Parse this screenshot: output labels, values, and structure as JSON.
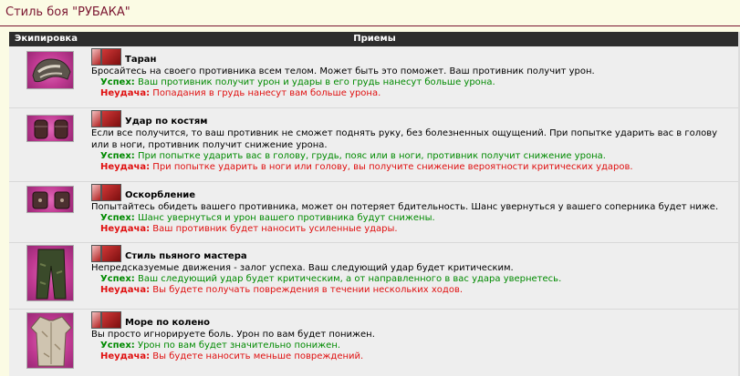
{
  "page": {
    "title": "Стиль боя \"РУБАКА\""
  },
  "table": {
    "col_equipment": "Экипировка",
    "col_moves": "Приемы"
  },
  "moves": [
    {
      "equip_icon": "helmet-icon",
      "name": "Таран",
      "desc": "Бросайтесь на своего противника всем телом. Может быть это поможет. Ваш противник получит урон.",
      "success_label": "Успех:",
      "success": "Ваш противник получит урон и удары в его грудь нанесут больше урона.",
      "fail_label": "Неудача:",
      "fail": "Попадания в грудь нанесут вам больше урона."
    },
    {
      "equip_icon": "gloves-icon",
      "name": "Удар по костям",
      "desc": "Если все получится, то ваш противник не сможет поднять руку, без болезненных ощущений. При попытке ударить вас в голову или в ноги, противник получит снижение урона.",
      "success_label": "Успех:",
      "success": "При попытке ударить вас в голову, грудь, пояс или в ноги, противник получит снижение урона.",
      "fail_label": "Неудача:",
      "fail": "При попытке ударить в ноги или голову, вы получите снижение вероятности критических ударов."
    },
    {
      "equip_icon": "bracers-icon",
      "name": "Оскорбление",
      "desc": "Попытайтесь обидеть вашего противника, может он потеряет бдительность. Шанс увернуться у вашего соперника будет ниже.",
      "success_label": "Успех:",
      "success": "Шанс увернуться и урон вашего противника будут снижены.",
      "fail_label": "Неудача:",
      "fail": "Ваш противник будет наносить усиленные удары."
    },
    {
      "equip_icon": "pants-icon",
      "name": "Стиль пьяного мастера",
      "desc": "Непредсказуемые движения - залог успеха. Ваш следующий удар будет критическим.",
      "success_label": "Успех:",
      "success": "Ваш следующий удар будет критическим, а от направленного в вас удара увернетесь.",
      "fail_label": "Неудача:",
      "fail": "Вы будете получать повреждения в течении нескольких ходов."
    },
    {
      "equip_icon": "shirt-icon",
      "name": "Море по колено",
      "desc": "Вы просто игнорируете боль. Урон по вам будет понижен.",
      "success_label": "Успех:",
      "success": "Урон по вам будет значительно понижен.",
      "fail_label": "Неудача:",
      "fail": "Вы будете наносить меньше повреждений."
    }
  ]
}
